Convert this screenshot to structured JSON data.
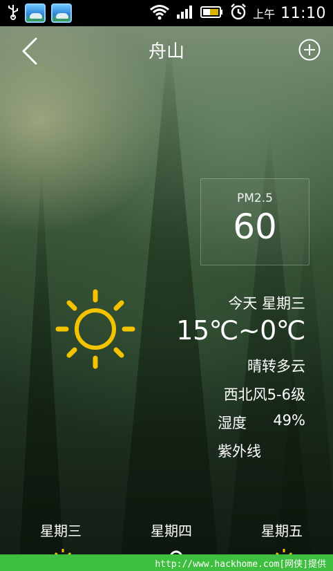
{
  "status": {
    "ampm": "上午",
    "time": "11:10"
  },
  "header": {
    "title": "舟山"
  },
  "pm25": {
    "label": "PM2.5",
    "value": "60"
  },
  "today": {
    "day": "今天 星期三",
    "temp_range": "15℃~0℃",
    "condition": "晴转多云",
    "wind": "西北风5-6级",
    "humidity_label": "湿度",
    "humidity_value": "49%",
    "uv_label": "紫外线"
  },
  "forecast": [
    {
      "day": "星期三"
    },
    {
      "day": "星期四"
    },
    {
      "day": "星期五"
    }
  ],
  "watermark": "http://www.hackhome.com[网侠]提供",
  "colors": {
    "sun": "#f5c200",
    "watermark_bg": "#3fbf3f"
  }
}
